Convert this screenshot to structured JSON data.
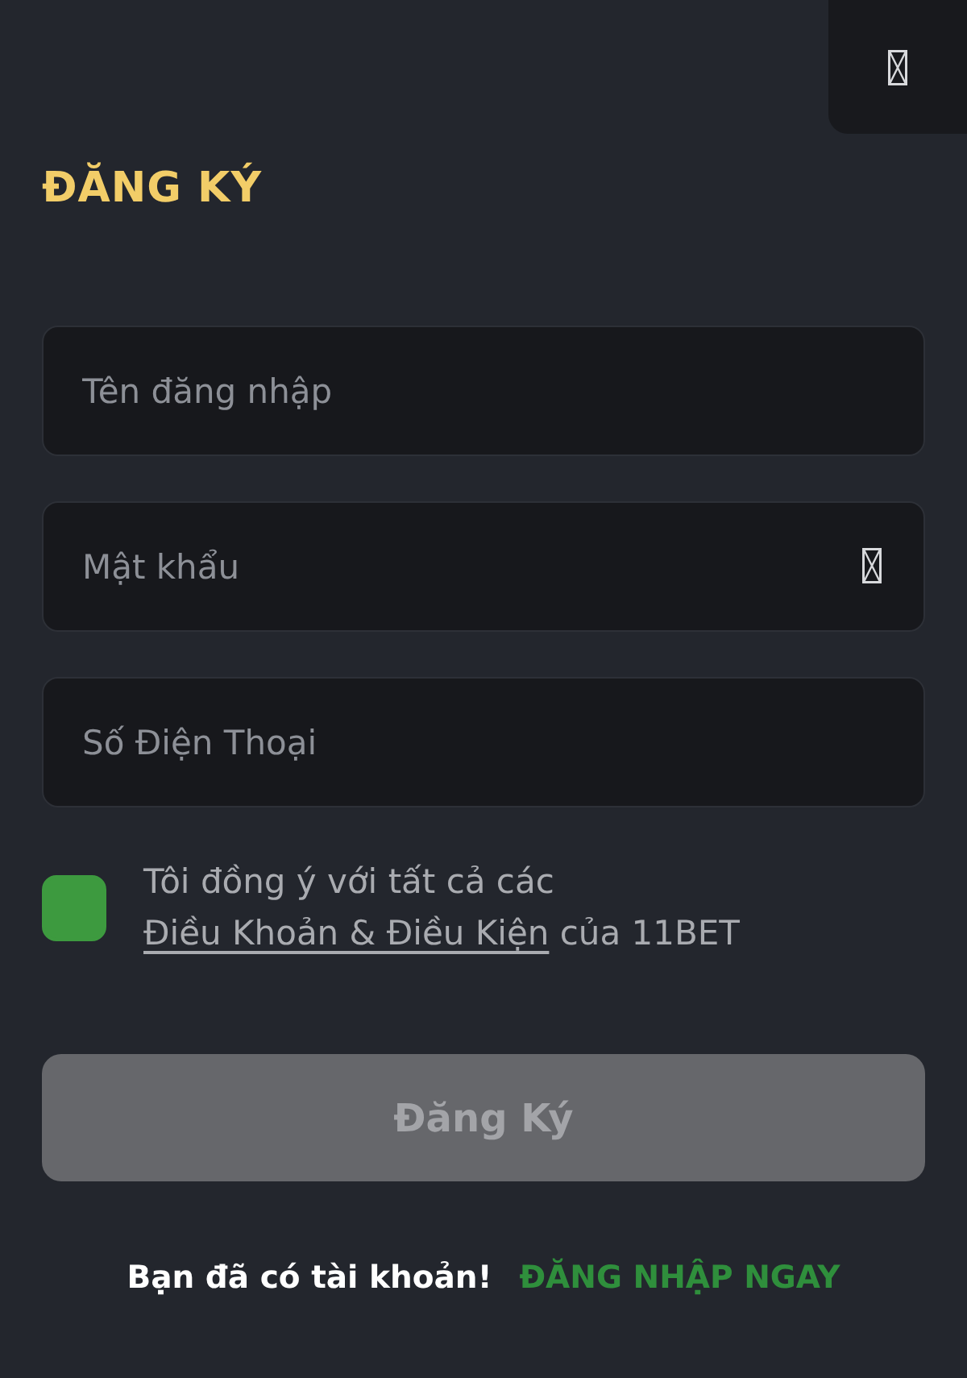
{
  "title": "ĐĂNG KÝ",
  "fields": [
    {
      "kind": "text",
      "placeholder": "Tên đăng nhập"
    },
    {
      "kind": "password",
      "placeholder": "Mật khẩu"
    },
    {
      "kind": "text",
      "placeholder": "Số Điện Thoại"
    }
  ],
  "agreement": {
    "checked": true,
    "text_before": "Tôi đồng ý với tất cả các",
    "link": "Điều Khoản & Điều Kiện",
    "text_after": "của 11BET"
  },
  "submit_button": {
    "label": "Đăng Ký",
    "disabled": true
  },
  "login_prompt": {
    "text": "Bạn đã có tài khoản!",
    "link": "ĐĂNG NHẬP NGAY"
  }
}
